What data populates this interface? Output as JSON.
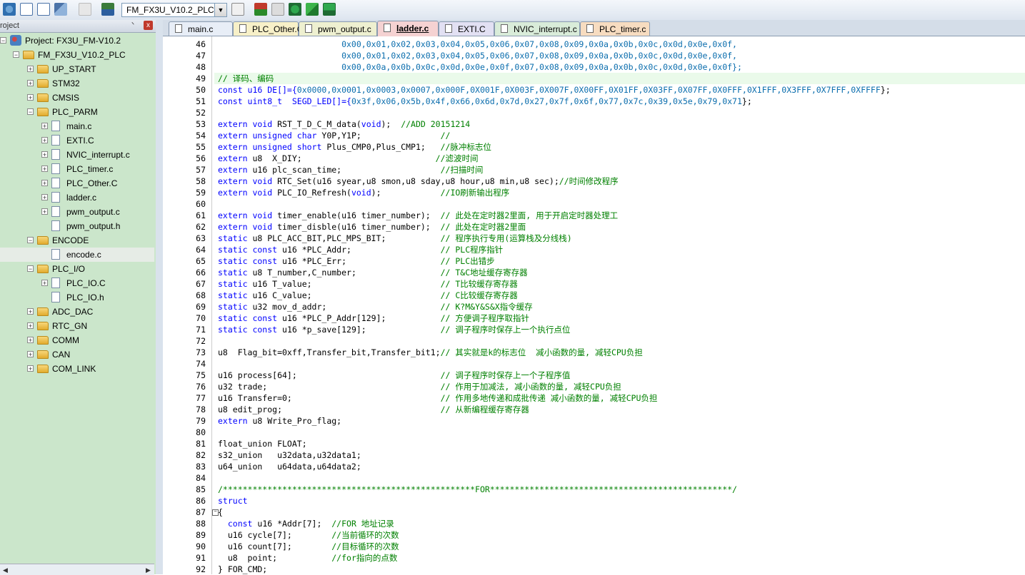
{
  "toolbar": {
    "target_name": "FM_FX3U_V10.2_PLC",
    "target_dropdown_icon": "chevron-down-icon"
  },
  "project_panel": {
    "title": "roject",
    "pin_glyph": "ᐠ",
    "close_glyph": "x",
    "tree": [
      {
        "label": "Project: FX3U_FM-V10.2",
        "level": 0,
        "type": "project",
        "expanded": true
      },
      {
        "label": "FM_FX3U_V10.2_PLC",
        "level": 1,
        "type": "target",
        "expanded": true
      },
      {
        "label": "UP_START",
        "level": 2,
        "type": "folder",
        "expanded": false
      },
      {
        "label": "STM32",
        "level": 2,
        "type": "folder",
        "expanded": false
      },
      {
        "label": "CMSIS",
        "level": 2,
        "type": "folder",
        "expanded": false
      },
      {
        "label": "PLC_PARM",
        "level": 2,
        "type": "folder",
        "expanded": true
      },
      {
        "label": "main.c",
        "level": 3,
        "type": "file",
        "expandable": true
      },
      {
        "label": "EXTI.C",
        "level": 3,
        "type": "file",
        "expandable": true
      },
      {
        "label": "NVIC_interrupt.c",
        "level": 3,
        "type": "file",
        "expandable": true
      },
      {
        "label": "PLC_timer.c",
        "level": 3,
        "type": "file",
        "expandable": true
      },
      {
        "label": "PLC_Other.C",
        "level": 3,
        "type": "file",
        "expandable": true
      },
      {
        "label": "ladder.c",
        "level": 3,
        "type": "file",
        "expandable": true
      },
      {
        "label": "pwm_output.c",
        "level": 3,
        "type": "file",
        "expandable": true
      },
      {
        "label": "pwm_output.h",
        "level": 3,
        "type": "file",
        "expandable": false
      },
      {
        "label": "ENCODE",
        "level": 2,
        "type": "folder",
        "expanded": true
      },
      {
        "label": "encode.c",
        "level": 3,
        "type": "file",
        "expandable": false,
        "selected": true
      },
      {
        "label": "PLC_I/O",
        "level": 2,
        "type": "folder",
        "expanded": true
      },
      {
        "label": "PLC_IO.C",
        "level": 3,
        "type": "file",
        "expandable": true
      },
      {
        "label": "PLC_IO.h",
        "level": 3,
        "type": "file",
        "expandable": false
      },
      {
        "label": "ADC_DAC",
        "level": 2,
        "type": "folder",
        "expanded": false
      },
      {
        "label": "RTC_GN",
        "level": 2,
        "type": "folder",
        "expanded": false
      },
      {
        "label": "COMM",
        "level": 2,
        "type": "folder",
        "expanded": false
      },
      {
        "label": "CAN",
        "level": 2,
        "type": "folder",
        "expanded": false
      },
      {
        "label": "COM_LINK",
        "level": 2,
        "type": "folder",
        "expanded": false
      }
    ]
  },
  "tabs": [
    {
      "label": "main.c",
      "color": "#e8eef7",
      "active": false
    },
    {
      "label": "PLC_Other.C",
      "color": "#f7f0c8",
      "active": false
    },
    {
      "label": "pwm_output.c",
      "color": "#eef0d0",
      "active": false
    },
    {
      "label": "ladder.c",
      "color": "#f5d2d2",
      "active": true
    },
    {
      "label": "EXTI.C",
      "color": "#e2e0f3",
      "active": false
    },
    {
      "label": "NVIC_interrupt.c",
      "color": "#d9ecd9",
      "active": false
    },
    {
      "label": "PLC_timer.c",
      "color": "#f7dcc0",
      "active": false
    }
  ],
  "editor": {
    "lines": [
      {
        "n": "46",
        "segs": [
          {
            "t": "                         0x00,0x01,0x02,0x03,0x04,0x05,0x06,0x07,0x08,0x09,0x0a,0x0b,0x0c,0x0d,0x0e,0x0f,",
            "c": "n"
          }
        ]
      },
      {
        "n": "47",
        "segs": [
          {
            "t": "                         0x00,0x01,0x02,0x03,0x04,0x05,0x06,0x07,0x08,0x09,0x0a,0x0b,0x0c,0x0d,0x0e,0x0f,",
            "c": "n"
          }
        ]
      },
      {
        "n": "48",
        "segs": [
          {
            "t": "                         0x00,0x0a,0x0b,0x0c,0x0d,0x0e,0x0f,0x07,0x08,0x09,0x0a,0x0b,0x0c,0x0d,0x0e,0x0f};",
            "c": "n"
          }
        ]
      },
      {
        "n": "49",
        "segs": [
          {
            "t": "// 译码、编码",
            "c": "c"
          }
        ]
      },
      {
        "n": "50",
        "segs": [
          {
            "t": "const u16 DE[]={",
            "c": "k"
          },
          {
            "t": "0x0000,0x0001,0x0003,0x0007,0x000F,0X001F,0X003F,0X007F,0X00FF,0X01FF,0X03FF,0X07FF,0X0FFF,0X1FFF,0X3FFF,0X7FFF,0XFFFF",
            "c": "n"
          },
          {
            "t": "};",
            "c": ""
          }
        ]
      },
      {
        "n": "51",
        "segs": [
          {
            "t": "const uint8_t  SEGD_LED[]={",
            "c": "k"
          },
          {
            "t": "0x3f,0x06,0x5b,0x4f,0x66,0x6d,0x7d,0x27,0x7f,0x6f,0x77,0x7c,0x39,0x5e,0x79,0x71",
            "c": "n"
          },
          {
            "t": "};",
            "c": ""
          }
        ]
      },
      {
        "n": "52",
        "segs": []
      },
      {
        "n": "53",
        "segs": [
          {
            "t": "extern void ",
            "c": "k"
          },
          {
            "t": "RST_T_D_C_M_data(",
            "c": ""
          },
          {
            "t": "void",
            "c": "k"
          },
          {
            "t": ");  ",
            "c": ""
          },
          {
            "t": "//ADD 20151214",
            "c": "c"
          }
        ]
      },
      {
        "n": "54",
        "segs": [
          {
            "t": "extern unsigned char ",
            "c": "k"
          },
          {
            "t": "Y0P,Y1P;                ",
            "c": ""
          },
          {
            "t": "//",
            "c": "c"
          }
        ]
      },
      {
        "n": "55",
        "segs": [
          {
            "t": "extern unsigned short ",
            "c": "k"
          },
          {
            "t": "Plus_CMP0,Plus_CMP1;   ",
            "c": ""
          },
          {
            "t": "//脉冲标志位",
            "c": "c"
          }
        ]
      },
      {
        "n": "56",
        "segs": [
          {
            "t": "extern ",
            "c": "k"
          },
          {
            "t": "u8  X_DIY;                           ",
            "c": ""
          },
          {
            "t": "//滤波时间",
            "c": "c"
          }
        ]
      },
      {
        "n": "57",
        "segs": [
          {
            "t": "extern ",
            "c": "k"
          },
          {
            "t": "u16 plc_scan_time;                    ",
            "c": ""
          },
          {
            "t": "//扫描时间",
            "c": "c"
          }
        ]
      },
      {
        "n": "58",
        "segs": [
          {
            "t": "extern void ",
            "c": "k"
          },
          {
            "t": "RTC_Set(u16 syear,u8 smon,u8 sday,u8 hour,u8 min,u8 sec);",
            "c": ""
          },
          {
            "t": "//时间修改程序",
            "c": "c"
          }
        ]
      },
      {
        "n": "59",
        "segs": [
          {
            "t": "extern void ",
            "c": "k"
          },
          {
            "t": "PLC_IO_Refresh(",
            "c": ""
          },
          {
            "t": "void",
            "c": "k"
          },
          {
            "t": ");            ",
            "c": ""
          },
          {
            "t": "//IO刷新输出程序",
            "c": "c"
          }
        ]
      },
      {
        "n": "60",
        "segs": []
      },
      {
        "n": "61",
        "segs": [
          {
            "t": "extern void ",
            "c": "k"
          },
          {
            "t": "timer_enable(u16 timer_number);  ",
            "c": ""
          },
          {
            "t": "// 此处在定时器2里面, 用于开启定时器处理工",
            "c": "c"
          }
        ]
      },
      {
        "n": "62",
        "segs": [
          {
            "t": "extern void ",
            "c": "k"
          },
          {
            "t": "timer_disble(u16 timer_number);  ",
            "c": ""
          },
          {
            "t": "// 此处在定时器2里面",
            "c": "c"
          }
        ]
      },
      {
        "n": "63",
        "segs": [
          {
            "t": "static ",
            "c": "k"
          },
          {
            "t": "u8 PLC_ACC_BIT,PLC_MPS_BIT;           ",
            "c": ""
          },
          {
            "t": "// 程序执行专用(运算栈及分线栈)",
            "c": "c"
          }
        ]
      },
      {
        "n": "64",
        "segs": [
          {
            "t": "static const ",
            "c": "k"
          },
          {
            "t": "u16 *PLC_Addr;                  ",
            "c": ""
          },
          {
            "t": "// PLC程序指针",
            "c": "c"
          }
        ]
      },
      {
        "n": "65",
        "segs": [
          {
            "t": "static const ",
            "c": "k"
          },
          {
            "t": "u16 *PLC_Err;                   ",
            "c": ""
          },
          {
            "t": "// PLC出错步",
            "c": "c"
          }
        ]
      },
      {
        "n": "66",
        "segs": [
          {
            "t": "static ",
            "c": "k"
          },
          {
            "t": "u8 T_number,C_number;                 ",
            "c": ""
          },
          {
            "t": "// T&C地址缓存寄存器",
            "c": "c"
          }
        ]
      },
      {
        "n": "67",
        "segs": [
          {
            "t": "static ",
            "c": "k"
          },
          {
            "t": "u16 T_value;                          ",
            "c": ""
          },
          {
            "t": "// T比较缓存寄存器",
            "c": "c"
          }
        ]
      },
      {
        "n": "68",
        "segs": [
          {
            "t": "static ",
            "c": "k"
          },
          {
            "t": "u16 C_value;                          ",
            "c": ""
          },
          {
            "t": "// C比较缓存寄存器",
            "c": "c"
          }
        ]
      },
      {
        "n": "69",
        "segs": [
          {
            "t": "static ",
            "c": "k"
          },
          {
            "t": "u32 mov_d_addr;                       ",
            "c": ""
          },
          {
            "t": "// K?M&Y&S&X指令缓存",
            "c": "c"
          }
        ]
      },
      {
        "n": "70",
        "segs": [
          {
            "t": "static const ",
            "c": "k"
          },
          {
            "t": "u16 *PLC_P_Addr[129];           ",
            "c": ""
          },
          {
            "t": "// 方便调子程序取指针",
            "c": "c"
          }
        ]
      },
      {
        "n": "71",
        "segs": [
          {
            "t": "static const ",
            "c": "k"
          },
          {
            "t": "u16 *p_save[129];               ",
            "c": ""
          },
          {
            "t": "// 调子程序时保存上一个执行点位",
            "c": "c"
          }
        ]
      },
      {
        "n": "72",
        "segs": []
      },
      {
        "n": "73",
        "segs": [
          {
            "t": "u8  Flag_bit=0xff,Transfer_bit,Transfer_bit1;",
            "c": ""
          },
          {
            "t": "// 其实就是k的标志位  减小函数的量, 减轻CPU负担",
            "c": "c"
          }
        ]
      },
      {
        "n": "74",
        "segs": []
      },
      {
        "n": "75",
        "segs": [
          {
            "t": "u16 process[64];                             ",
            "c": ""
          },
          {
            "t": "// 调子程序时保存上一个子程序值",
            "c": "c"
          }
        ]
      },
      {
        "n": "76",
        "segs": [
          {
            "t": "u32 trade;                                   ",
            "c": ""
          },
          {
            "t": "// 作用于加减法, 减小函数的量, 减轻CPU负担",
            "c": "c"
          }
        ]
      },
      {
        "n": "77",
        "segs": [
          {
            "t": "u16 Transfer=0;                              ",
            "c": ""
          },
          {
            "t": "// 作用多地传递和成批传递 减小函数的量, 减轻CPU负担",
            "c": "c"
          }
        ]
      },
      {
        "n": "78",
        "segs": [
          {
            "t": "u8 edit_prog;                                ",
            "c": ""
          },
          {
            "t": "// 从新编程缓存寄存器",
            "c": "c"
          }
        ]
      },
      {
        "n": "79",
        "segs": [
          {
            "t": "extern ",
            "c": "k"
          },
          {
            "t": "u8 Write_Pro_flag;",
            "c": ""
          }
        ]
      },
      {
        "n": "80",
        "segs": []
      },
      {
        "n": "81",
        "segs": [
          {
            "t": "float_union FLOAT;",
            "c": ""
          }
        ]
      },
      {
        "n": "82",
        "segs": [
          {
            "t": "s32_union   u32data,u32data1;",
            "c": ""
          }
        ]
      },
      {
        "n": "83",
        "segs": [
          {
            "t": "u64_union   u64data,u64data2;",
            "c": ""
          }
        ]
      },
      {
        "n": "84",
        "segs": []
      },
      {
        "n": "85",
        "segs": [
          {
            "t": "/***************************************************FOR*************************************************/",
            "c": "c"
          }
        ]
      },
      {
        "n": "86",
        "segs": [
          {
            "t": "struct",
            "c": "k"
          }
        ]
      },
      {
        "n": "87",
        "segs": [
          {
            "t": "{",
            "c": ""
          }
        ]
      },
      {
        "n": "88",
        "segs": [
          {
            "t": "  const ",
            "c": "k"
          },
          {
            "t": "u16 *Addr[7];  ",
            "c": ""
          },
          {
            "t": "//FOR 地址记录",
            "c": "c"
          }
        ]
      },
      {
        "n": "89",
        "segs": [
          {
            "t": "  u16 cycle[7];        ",
            "c": ""
          },
          {
            "t": "//当前循环的次数",
            "c": "c"
          }
        ]
      },
      {
        "n": "90",
        "segs": [
          {
            "t": "  u16 count[7];        ",
            "c": ""
          },
          {
            "t": "//目标循环的次数",
            "c": "c"
          }
        ]
      },
      {
        "n": "91",
        "segs": [
          {
            "t": "  u8  point;           ",
            "c": ""
          },
          {
            "t": "//for指向的点数",
            "c": "c"
          }
        ]
      },
      {
        "n": "92",
        "segs": [
          {
            "t": "} FOR_CMD;",
            "c": ""
          }
        ]
      }
    ]
  }
}
